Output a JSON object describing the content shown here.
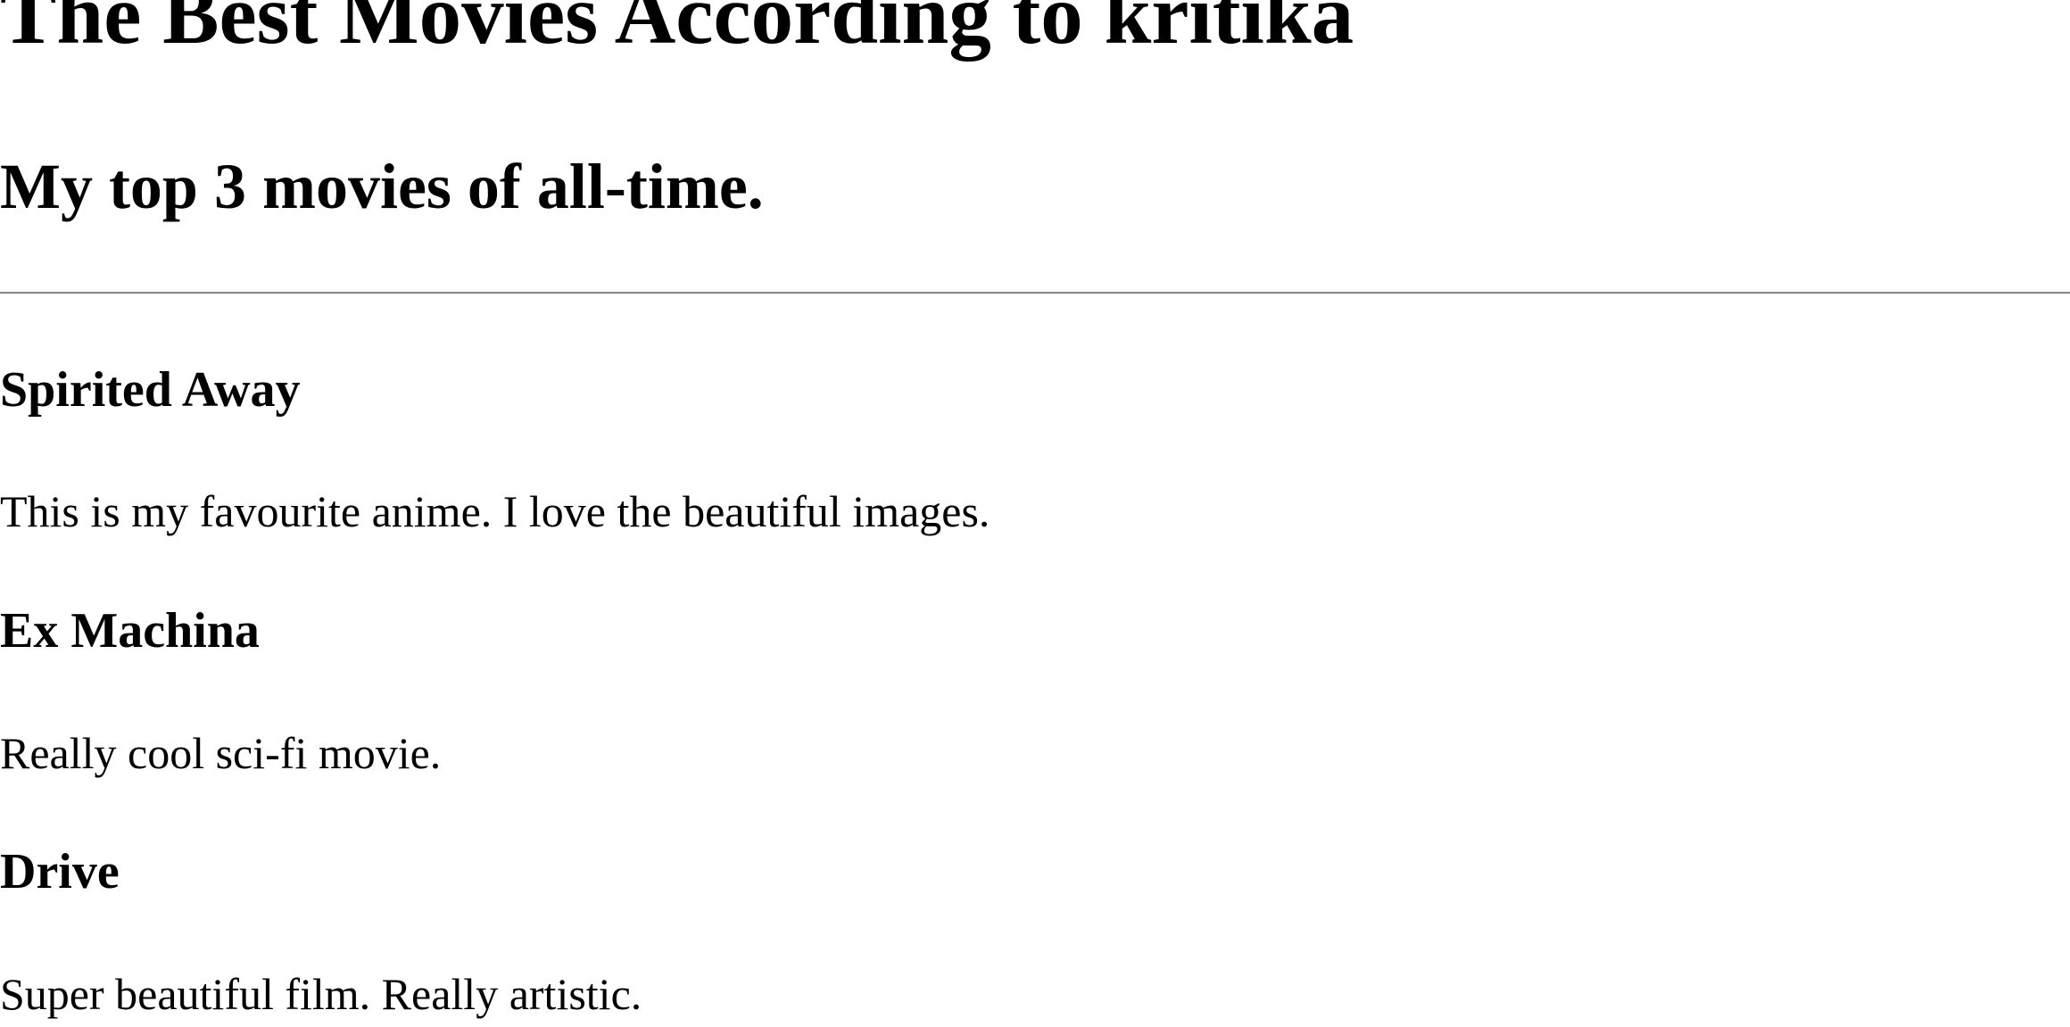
{
  "page": {
    "title": "The Best Movies According to kritika",
    "subtitle": "My top 3 movies of all-time."
  },
  "movies": [
    {
      "title": "Spirited Away",
      "description": "This is my favourite anime. I love the beautiful images."
    },
    {
      "title": "Ex Machina",
      "description": "Really cool sci-fi movie."
    },
    {
      "title": "Drive",
      "description": "Super beautiful film. Really artistic."
    }
  ]
}
